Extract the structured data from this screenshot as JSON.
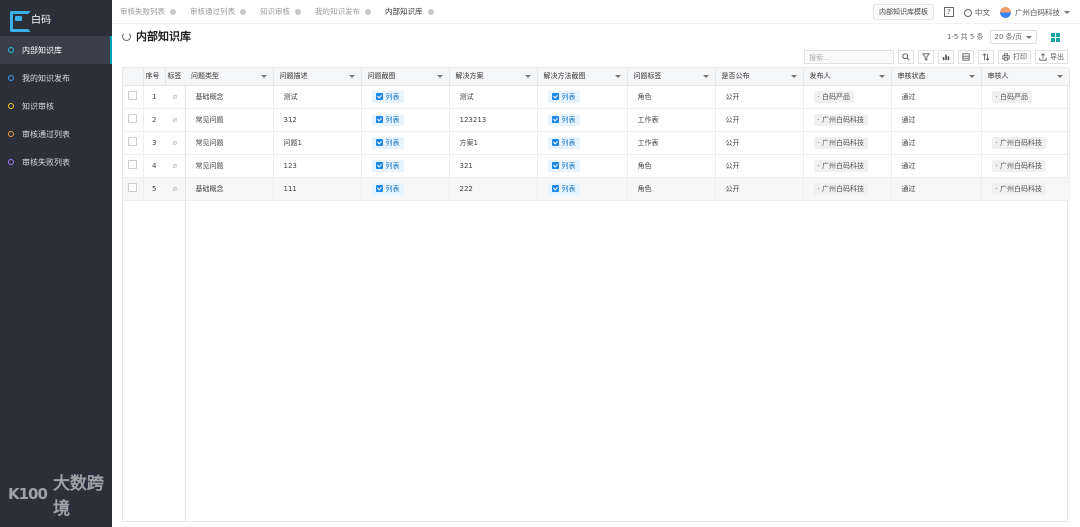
{
  "brand": {
    "name": "白码"
  },
  "sidebar": {
    "items": [
      {
        "label": "内部知识库",
        "color": "#22c3d6",
        "active": true
      },
      {
        "label": "我的知识发布",
        "color": "#3b9bf5",
        "active": false
      },
      {
        "label": "知识审核",
        "color": "#f2d233",
        "active": false
      },
      {
        "label": "审核通过列表",
        "color": "#f59a3b",
        "active": false
      },
      {
        "label": "审核失败列表",
        "color": "#a77cf5",
        "active": false
      }
    ]
  },
  "watermark": {
    "logo_text": "K100",
    "text": "大数跨境"
  },
  "tabs": [
    {
      "label": "审核失败列表",
      "active": false
    },
    {
      "label": "审核通过列表",
      "active": false
    },
    {
      "label": "知识审核",
      "active": false
    },
    {
      "label": "我的知识发布",
      "active": false
    },
    {
      "label": "内部知识库",
      "active": true
    }
  ],
  "topbar": {
    "template_button": "内部知识库模板",
    "help": "?",
    "language": "中文",
    "company": "广州白码科技"
  },
  "page": {
    "title": "内部知识库"
  },
  "pager": {
    "summary": "1-5 共 5 条",
    "page_size": "20 条/页"
  },
  "toolbar": {
    "search_placeholder": "搜索...",
    "print_label": "打印",
    "export_label": "导出"
  },
  "table": {
    "headers": [
      "序号",
      "标签",
      "问题类型",
      "问题描述",
      "问题截图",
      "解决方案",
      "解决方法截图",
      "问题标签",
      "是否公布",
      "发布人",
      "审核状态",
      "审核人"
    ],
    "rows": [
      {
        "seq": "1",
        "type": "基础概念",
        "desc": "测试",
        "shot": "列表",
        "solution": "测试",
        "solshot": "列表",
        "tag": "角色",
        "public": "公开",
        "publisher": "白码严品",
        "status": "通过",
        "reviewer": "白码严品"
      },
      {
        "seq": "2",
        "type": "常见问题",
        "desc": "312",
        "shot": "列表",
        "solution": "123213",
        "solshot": "列表",
        "tag": "工作表",
        "public": "公开",
        "publisher": "广州白码科技",
        "status": "通过",
        "reviewer": ""
      },
      {
        "seq": "3",
        "type": "常见问题",
        "desc": "问题1",
        "shot": "列表",
        "solution": "方案1",
        "solshot": "列表",
        "tag": "工作表",
        "public": "公开",
        "publisher": "广州白码科技",
        "status": "通过",
        "reviewer": "广州白码科技"
      },
      {
        "seq": "4",
        "type": "常见问题",
        "desc": "123",
        "shot": "列表",
        "solution": "321",
        "solshot": "列表",
        "tag": "角色",
        "public": "公开",
        "publisher": "广州白码科技",
        "status": "通过",
        "reviewer": "广州白码科技"
      },
      {
        "seq": "5",
        "type": "基础概念",
        "desc": "111",
        "shot": "列表",
        "solution": "222",
        "solshot": "列表",
        "tag": "角色",
        "public": "公开",
        "publisher": "广州白码科技",
        "status": "通过",
        "reviewer": "广州白码科技"
      }
    ]
  }
}
